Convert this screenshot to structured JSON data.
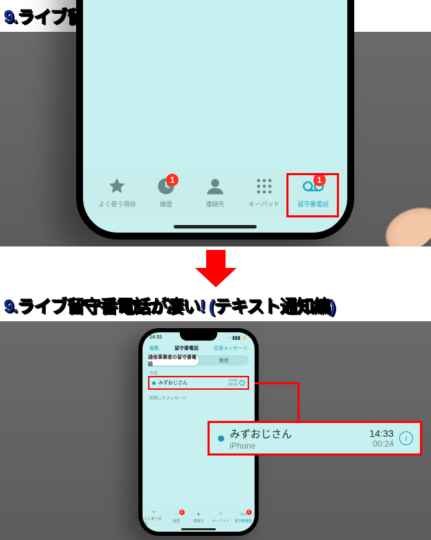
{
  "title": "9.ライブ留守番電話が凄い! (テキスト通知編)",
  "tabbar": {
    "items": [
      {
        "label": "よく使う項目"
      },
      {
        "label": "履歴",
        "badge": "1"
      },
      {
        "label": "連絡先"
      },
      {
        "label": "キーパッド"
      },
      {
        "label": "留守番電話",
        "badge": "1"
      }
    ]
  },
  "phone2": {
    "time": "14:33",
    "nav_left": "編集",
    "nav_title": "留守番電話",
    "nav_right": "応答メッセージ",
    "seg_left": "通信事業者の留守番電話",
    "seg_right": "発信",
    "section_today": "今日",
    "section_deleted": "削除したメッセージ",
    "vm": {
      "name": "みずおじさん",
      "time": "14:33",
      "dur": "00:24"
    }
  },
  "callout": {
    "name": "みずおじさん",
    "sub": "iPhone",
    "time": "14:33",
    "dur": "00:24"
  }
}
